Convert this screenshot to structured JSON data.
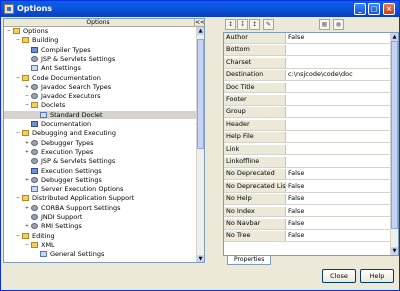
{
  "window": {
    "title": "Options",
    "min_glyph": "_",
    "max_glyph": "□",
    "close_glyph": "×"
  },
  "tree": {
    "header": "Options",
    "collapse_glyph": "<<",
    "items": [
      {
        "label": "Options",
        "level": 0,
        "toggle": "−",
        "icon": "folder"
      },
      {
        "label": "Building",
        "level": 1,
        "toggle": "−",
        "icon": "folder"
      },
      {
        "label": "Compiler Types",
        "level": 2,
        "toggle": "",
        "icon": "pkg"
      },
      {
        "label": "JSP & Servlets Settings",
        "level": 2,
        "toggle": "",
        "icon": "gear"
      },
      {
        "label": "Ant Settings",
        "level": 2,
        "toggle": "",
        "icon": "leaf"
      },
      {
        "label": "Code Documentation",
        "level": 1,
        "toggle": "−",
        "icon": "folder"
      },
      {
        "label": "Javadoc Search Types",
        "level": 2,
        "toggle": "+",
        "icon": "gear"
      },
      {
        "label": "Javadoc Executors",
        "level": 2,
        "toggle": "−",
        "icon": "gear"
      },
      {
        "label": "Doclets",
        "level": 2,
        "toggle": "−",
        "icon": "folder"
      },
      {
        "label": "Standard Doclet",
        "level": 3,
        "toggle": "",
        "icon": "leaf",
        "selected": true,
        "marked": true
      },
      {
        "label": "Documentation",
        "level": 2,
        "toggle": "",
        "icon": "pkg",
        "marked": true
      },
      {
        "label": "Debugging and Executing",
        "level": 1,
        "toggle": "−",
        "icon": "folder"
      },
      {
        "label": "Debugger Types",
        "level": 2,
        "toggle": "+",
        "icon": "gear"
      },
      {
        "label": "Execution Types",
        "level": 2,
        "toggle": "+",
        "icon": "gear"
      },
      {
        "label": "JSP & Servlets Settings",
        "level": 2,
        "toggle": "",
        "icon": "gear"
      },
      {
        "label": "Execution Settings",
        "level": 2,
        "toggle": "",
        "icon": "pkg"
      },
      {
        "label": "Debugger Settings",
        "level": 2,
        "toggle": "+",
        "icon": "gear"
      },
      {
        "label": "Server Execution Options",
        "level": 2,
        "toggle": "",
        "icon": "leaf"
      },
      {
        "label": "Distributed Application Support",
        "level": 1,
        "toggle": "−",
        "icon": "folder"
      },
      {
        "label": "CORBA Support Settings",
        "level": 2,
        "toggle": "+",
        "icon": "gear"
      },
      {
        "label": "JNDI Support",
        "level": 2,
        "toggle": "",
        "icon": "gear"
      },
      {
        "label": "RMI Settings",
        "level": 2,
        "toggle": "+",
        "icon": "gear"
      },
      {
        "label": "Editing",
        "level": 1,
        "toggle": "−",
        "icon": "folder"
      },
      {
        "label": "XML",
        "level": 2,
        "toggle": "−",
        "icon": "folder"
      },
      {
        "label": "General Settings",
        "level": 3,
        "toggle": "",
        "icon": "leaf"
      }
    ]
  },
  "toolbar": {
    "b1": "↕",
    "b2": "↧",
    "b3": "↥",
    "b4": "✎",
    "b5": "■",
    "b6": "●"
  },
  "properties": [
    {
      "key": "Author",
      "value": "False"
    },
    {
      "key": "Bottom",
      "value": ""
    },
    {
      "key": "Charset",
      "value": ""
    },
    {
      "key": "Destination",
      "value": "c:\\nsjcode\\code\\doc"
    },
    {
      "key": "Doc Title",
      "value": ""
    },
    {
      "key": "Footer",
      "value": ""
    },
    {
      "key": "Group",
      "value": ""
    },
    {
      "key": "Header",
      "value": ""
    },
    {
      "key": "Help File",
      "value": ""
    },
    {
      "key": "Link",
      "value": ""
    },
    {
      "key": "Linkoffline",
      "value": ""
    },
    {
      "key": "No Deprecated",
      "value": "False"
    },
    {
      "key": "No Deprecated List",
      "value": "False"
    },
    {
      "key": "No Help",
      "value": "False"
    },
    {
      "key": "No Index",
      "value": "False"
    },
    {
      "key": "No Navbar",
      "value": "False"
    },
    {
      "key": "No Tree",
      "value": "False"
    }
  ],
  "tabs": {
    "properties": "Properties"
  },
  "buttons": {
    "close": "Close",
    "help": "Help"
  }
}
